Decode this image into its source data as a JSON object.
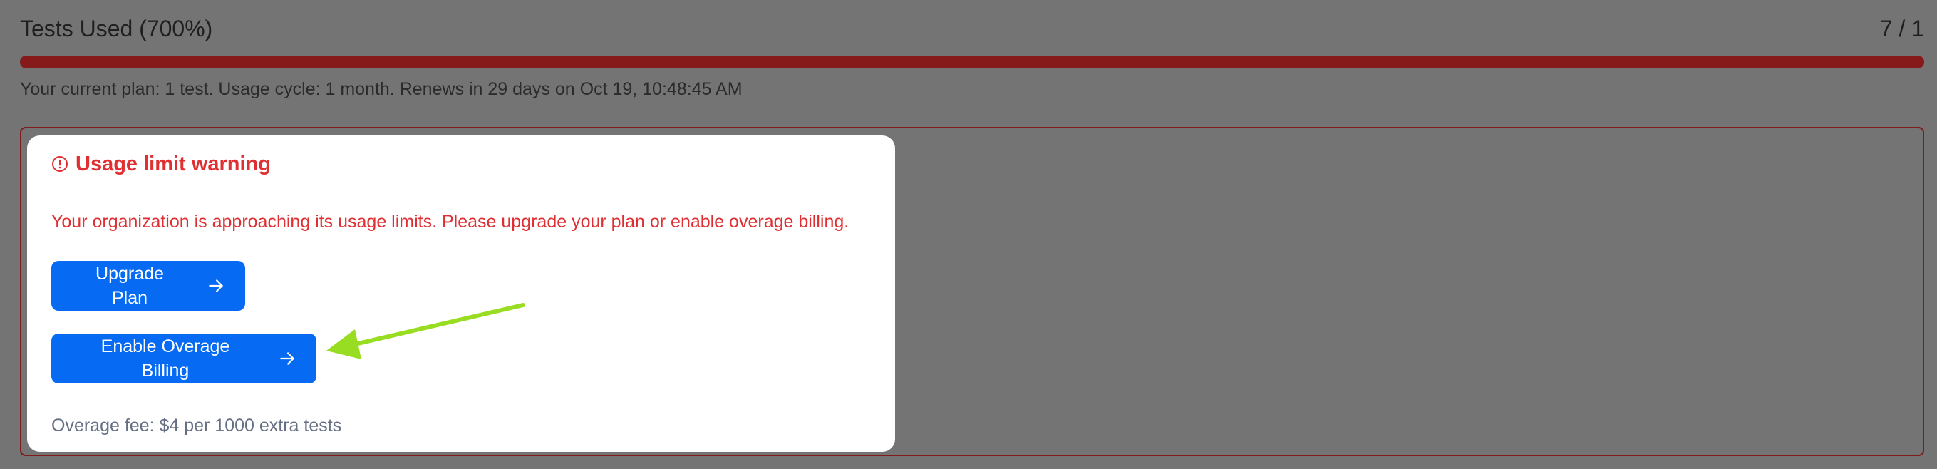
{
  "usage": {
    "title": "Tests Used (700%)",
    "count": "7 / 1",
    "plan_text": "Your current plan: 1 test. Usage cycle: 1 month. Renews in 29 days on Oct 19, 10:48:45 AM",
    "progress_fraction": 1.0,
    "progress_color": "#861919"
  },
  "warning": {
    "title": "Usage limit warning",
    "message": "Your organization is approaching its usage limits. Please upgrade your plan or enable overage billing.",
    "icon": "alert-circle-icon",
    "color": "#df2f32"
  },
  "actions": {
    "upgrade_label": "Upgrade Plan",
    "overage_label": "Enable Overage Billing",
    "button_color": "#066bf2",
    "arrow_icon": "arrow-right-icon"
  },
  "fee": {
    "text": "Overage fee: $4 per 1000 extra tests"
  },
  "annotation": {
    "icon": "green-pointer-arrow",
    "color": "#99dd22"
  }
}
